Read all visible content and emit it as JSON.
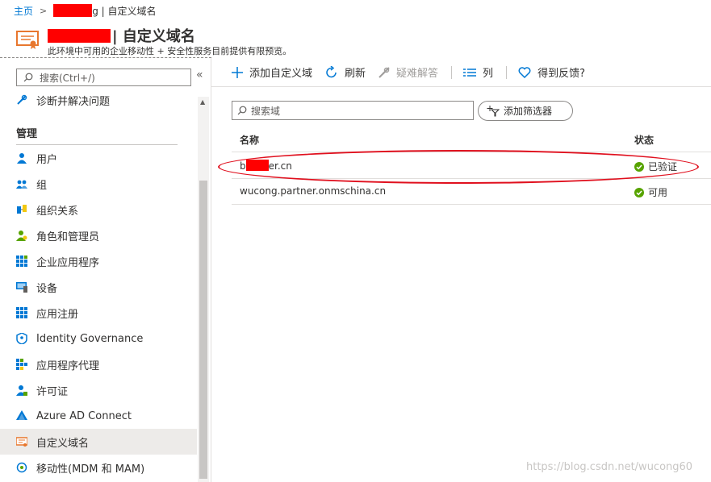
{
  "breadcrumb": {
    "home": "主页",
    "tail": "g | 自定义域名"
  },
  "header": {
    "title": "| 自定义域名",
    "subtitle": "此环境中可用的企业移动性 + 安全性服务目前提供有限预览。"
  },
  "sidebar": {
    "search_placeholder": "搜索(Ctrl+/)",
    "collapse_glyph": "«",
    "top_item": "诊断并解决问题",
    "section": "管理",
    "items": [
      {
        "label": "用户",
        "icon": "user-icon"
      },
      {
        "label": "组",
        "icon": "group-icon"
      },
      {
        "label": "组织关系",
        "icon": "org-relations-icon"
      },
      {
        "label": "角色和管理员",
        "icon": "roles-icon"
      },
      {
        "label": "企业应用程序",
        "icon": "apps-grid-icon"
      },
      {
        "label": "设备",
        "icon": "device-icon"
      },
      {
        "label": "应用注册",
        "icon": "app-registration-icon"
      },
      {
        "label": "Identity Governance",
        "icon": "identity-governance-icon"
      },
      {
        "label": "应用程序代理",
        "icon": "app-proxy-icon"
      },
      {
        "label": "许可证",
        "icon": "license-icon"
      },
      {
        "label": "Azure AD Connect",
        "icon": "azure-ad-connect-icon"
      },
      {
        "label": "自定义域名",
        "icon": "certificate-icon",
        "active": true
      },
      {
        "label": "移动性(MDM 和 MAM)",
        "icon": "mobility-icon"
      }
    ]
  },
  "toolbar": {
    "add": "添加自定义域",
    "refresh": "刷新",
    "troubleshoot": "疑难解答",
    "columns": "列",
    "feedback": "得到反馈?"
  },
  "filter": {
    "placeholder": "搜索域",
    "add_filter": "添加筛选器"
  },
  "table": {
    "headers": {
      "name": "名称",
      "status": "状态"
    },
    "rows": [
      {
        "name_prefix": "b",
        "name_suffix": "er.cn",
        "status": "已验证"
      },
      {
        "name": "wucong.partner.onmschina.cn",
        "status": "可用"
      }
    ]
  },
  "watermark": "https://blog.csdn.net/wucong60",
  "colors": {
    "accent": "#0078d4",
    "success": "#57a300",
    "annotation": "#e0101e",
    "redaction": "#ff0000"
  }
}
